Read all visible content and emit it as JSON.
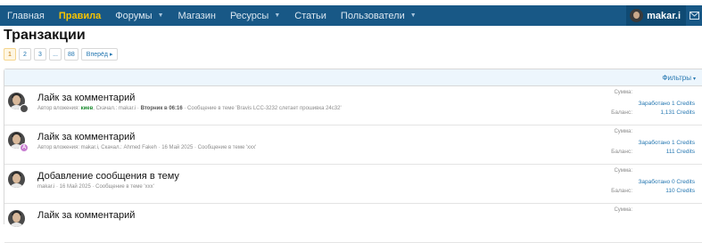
{
  "nav": {
    "items": [
      {
        "label": "Главная",
        "active": false,
        "has_caret": false
      },
      {
        "label": "Правила",
        "active": true,
        "has_caret": false
      },
      {
        "label": "Форумы",
        "active": false,
        "has_caret": true
      },
      {
        "label": "Магазин",
        "active": false,
        "has_caret": false
      },
      {
        "label": "Ресурсы",
        "active": false,
        "has_caret": true
      },
      {
        "label": "Статьи",
        "active": false,
        "has_caret": false
      },
      {
        "label": "Пользователи",
        "active": false,
        "has_caret": true
      }
    ],
    "username": "makar.i",
    "icons": {
      "caret": "chevron-down-icon",
      "mail": "mail-icon"
    }
  },
  "page": {
    "title": "Транзакции"
  },
  "pagination": {
    "pages": [
      "1",
      "2",
      "3",
      "...",
      "88"
    ],
    "current": "1",
    "next_label": "Вперёд ▸"
  },
  "filters": {
    "label": "Фильтры",
    "caret": "▾"
  },
  "transactions": [
    {
      "title": "Лайк за комментарий",
      "badge": "",
      "badge_color": "dark",
      "meta_prefix": "Автор вложения: ",
      "meta_author": "киев",
      "meta_rest": ", Скачал.: makar.i · ",
      "meta_date": "Вторник в 06:16",
      "meta_tail": " · Сообщение в теме 'Bravis LCC-3232 слетает прошивка 24c32'",
      "amount_label": "Сумма:",
      "earned": "Заработано 1 Credits",
      "balance_label": "Баланс:",
      "balance": "1,131 Credits"
    },
    {
      "title": "Лайк за комментарий",
      "badge": "A",
      "badge_color": "pink",
      "meta_prefix": "Автор вложения: makar.i, Скачал.: Ahmed Fakeh · ",
      "meta_author": "",
      "meta_rest": "",
      "meta_date": "16 Май 2025",
      "meta_tail": " · Сообщение в теме 'xxx'",
      "amount_label": "Сумма:",
      "earned": "Заработано 1 Credits",
      "balance_label": "Баланс:",
      "balance": "111 Credits"
    },
    {
      "title": "Добавление сообщения в тему",
      "badge": "",
      "badge_color": "",
      "meta_prefix": "makar.i · ",
      "meta_author": "",
      "meta_rest": "",
      "meta_date": "16 Май 2025",
      "meta_tail": " · Сообщение в теме 'xxx'",
      "amount_label": "Сумма:",
      "earned": "Заработано 0 Credits",
      "balance_label": "Баланс:",
      "balance": "110 Credits"
    },
    {
      "title": "Лайк за комментарий",
      "badge": "",
      "badge_color": "",
      "meta_prefix": "",
      "meta_author": "",
      "meta_rest": "",
      "meta_date": "",
      "meta_tail": "",
      "amount_label": "Сумма:",
      "earned": "",
      "balance_label": "",
      "balance": ""
    }
  ],
  "colors": {
    "nav_bg": "#185886",
    "nav_active": "#f7c300",
    "link": "#2577b1",
    "filter_bg": "#edf6fd"
  }
}
